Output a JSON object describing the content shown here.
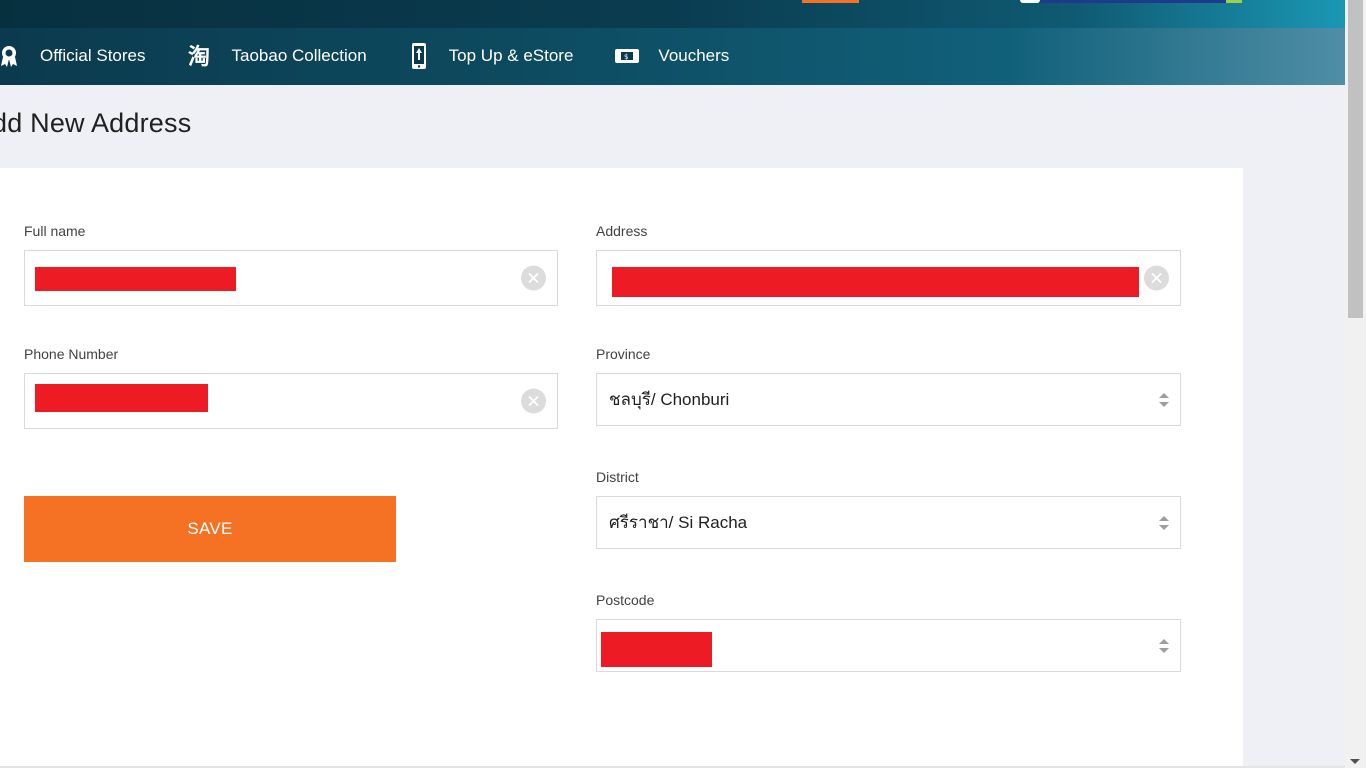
{
  "nav": {
    "items": [
      {
        "label": "Official Stores",
        "icon": "award-ribbon-icon"
      },
      {
        "label": "Taobao Collection",
        "icon": "taobao-icon"
      },
      {
        "label": "Top Up & eStore",
        "icon": "mobile-topup-icon"
      },
      {
        "label": "Vouchers",
        "icon": "voucher-icon"
      }
    ]
  },
  "page": {
    "title": "dd New Address"
  },
  "form": {
    "full_name": {
      "label": "Full name",
      "value": ""
    },
    "phone": {
      "label": "Phone Number",
      "value": ""
    },
    "address": {
      "label": "Address",
      "value": ""
    },
    "province": {
      "label": "Province",
      "value": "ชลบุรี/ Chonburi"
    },
    "district": {
      "label": "District",
      "value": "ศรีราชา/ Si Racha"
    },
    "postcode": {
      "label": "Postcode",
      "value": ""
    },
    "save_label": "SAVE"
  },
  "colors": {
    "accent": "#f57224",
    "header_dark": "#0b3a4e",
    "redaction": "#ed1c24"
  }
}
